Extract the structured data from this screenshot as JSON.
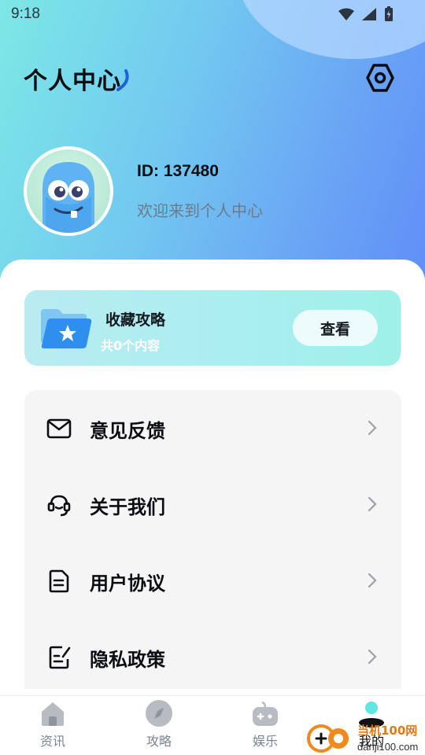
{
  "status_bar": {
    "time": "9:18"
  },
  "header": {
    "title": "个人中心"
  },
  "profile": {
    "id_text": "ID: 137480",
    "greeting": "欢迎来到个人中心"
  },
  "favorites": {
    "title": "收藏攻略",
    "count_text": "共0个内容",
    "view_label": "查看"
  },
  "menu": {
    "items": [
      {
        "label": "意见反馈",
        "icon": "mail-icon"
      },
      {
        "label": "关于我们",
        "icon": "headset-icon"
      },
      {
        "label": "用户协议",
        "icon": "document-icon"
      },
      {
        "label": "隐私政策",
        "icon": "edit-document-icon"
      }
    ]
  },
  "tabs": [
    {
      "label": "资讯",
      "icon": "home-icon",
      "active": false
    },
    {
      "label": "攻略",
      "icon": "compass-icon",
      "active": false
    },
    {
      "label": "娱乐",
      "icon": "gamepad-icon",
      "active": false
    },
    {
      "label": "我的",
      "icon": "profile-icon",
      "active": true
    }
  ],
  "watermark": {
    "brand": "当机100网",
    "url": "danji100.com"
  },
  "colors": {
    "header_gradient_start": "#7de8e6",
    "header_gradient_end": "#5f8ef7",
    "favorites_card": "#a9eef0",
    "menu_panel": "#f5f5f5",
    "tab_inactive": "#7b8591",
    "tab_active_dot": "#5fe7e0"
  }
}
